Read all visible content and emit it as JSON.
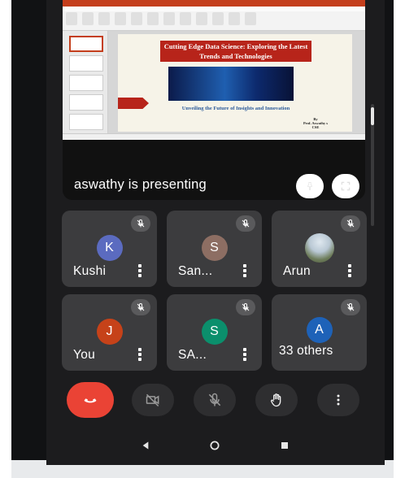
{
  "presentation": {
    "slide_title": "Cutting Edge Data Science: Exploring the Latest Trends and Technologies",
    "slide_subtitle": "Unveiling the Future of Insights and Innovation",
    "slide_byline": "By\nProf. Aswathy s\nCSE",
    "presenting_label": "aswathy is presenting"
  },
  "participants": [
    {
      "name": "Kushi",
      "initial": "K",
      "color": "#5b6bc0",
      "muted": true
    },
    {
      "name": "San...",
      "initial": "S",
      "color": "#8d6e63",
      "muted": true
    },
    {
      "name": "Arun",
      "initial": "",
      "color": "photo",
      "muted": true
    },
    {
      "name": "You",
      "initial": "J",
      "color": "#c64219",
      "muted": true
    },
    {
      "name": "SA...",
      "initial": "S",
      "color": "#0b8f6c",
      "muted": true
    },
    {
      "name": "33 others",
      "initial": "A",
      "color": "#1e62b8",
      "muted": true
    }
  ],
  "controls": {
    "hangup": "end-call-icon",
    "camera": "camera-off-icon",
    "mic": "mic-off-icon",
    "hand": "raise-hand-icon",
    "more": "more-vert-icon"
  },
  "colors": {
    "hangup": "#ea4335",
    "tile": "#3c3c3e",
    "background": "#1c1c1e",
    "slide_title_bg": "#b7241a"
  }
}
